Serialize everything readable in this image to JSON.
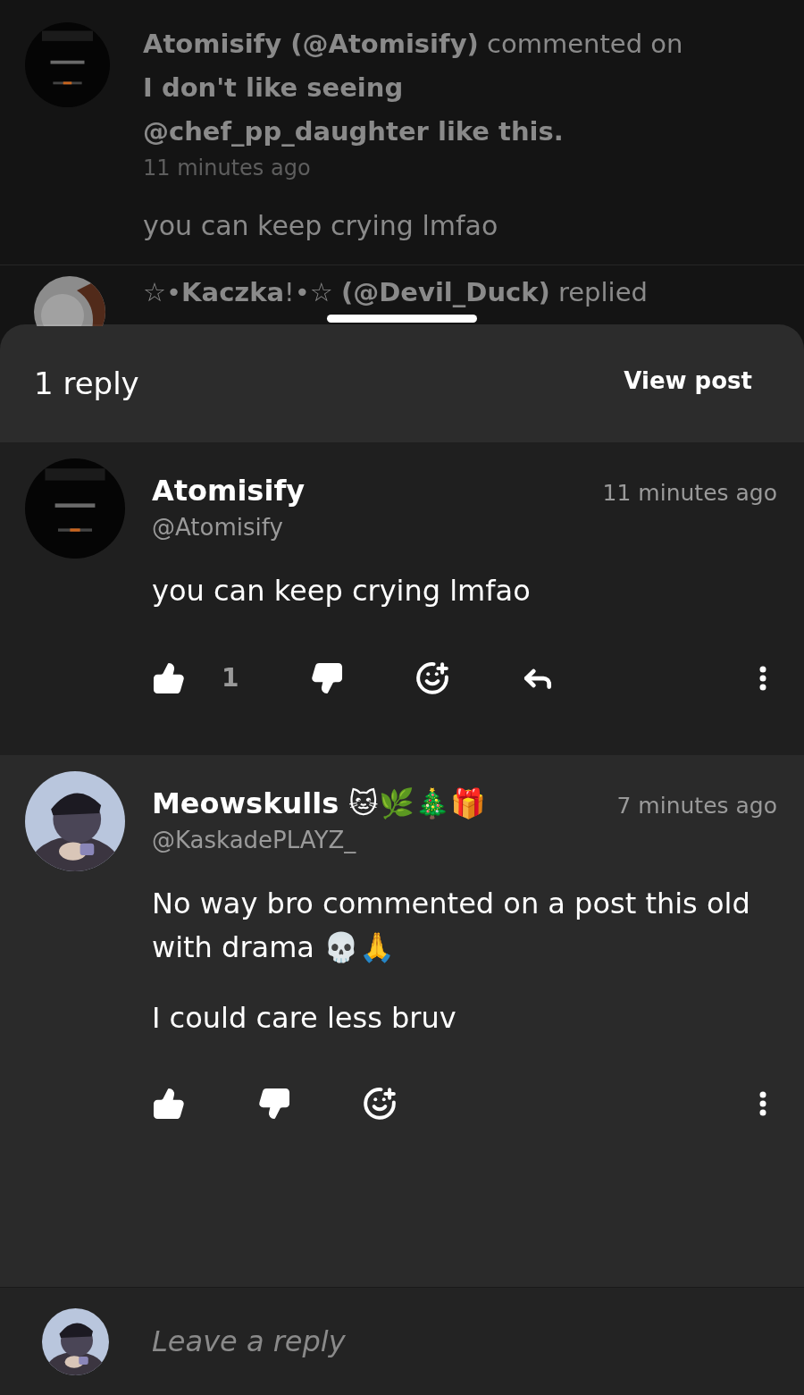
{
  "notifications": [
    {
      "text": "**Atomisify (@Atomisify)** commented on **I don't like seeing @chef_pp_daughter like this.**",
      "time": "11 minutes ago",
      "body": "you can keep crying lmfao"
    },
    {
      "text": "☆•**Kaczka**!•☆ **(@Devil_Duck)** replied"
    }
  ],
  "sheet": {
    "title": "1 reply",
    "view_post": "View post"
  },
  "comments": [
    {
      "name": "Atomisify",
      "handle": "@Atomisify",
      "time": "11 minutes ago",
      "paragraphs": [
        "you can keep crying lmfao"
      ],
      "actions": [
        {
          "kind": "like",
          "count": "1"
        },
        {
          "kind": "dislike"
        },
        {
          "kind": "react"
        },
        {
          "kind": "reply"
        },
        {
          "kind": "more"
        }
      ]
    },
    {
      "name": "Meowskulls 🐱🌿🎄🎁",
      "handle": "@KaskadePLAYZ_",
      "time": "7 minutes ago",
      "paragraphs": [
        "No way bro commented on a post this old with drama 💀🙏",
        "I could care less bruv"
      ],
      "actions": [
        {
          "kind": "like"
        },
        {
          "kind": "dislike"
        },
        {
          "kind": "react"
        },
        {
          "kind": "more"
        }
      ]
    }
  ],
  "reply_bar": {
    "placeholder": "Leave a reply"
  }
}
